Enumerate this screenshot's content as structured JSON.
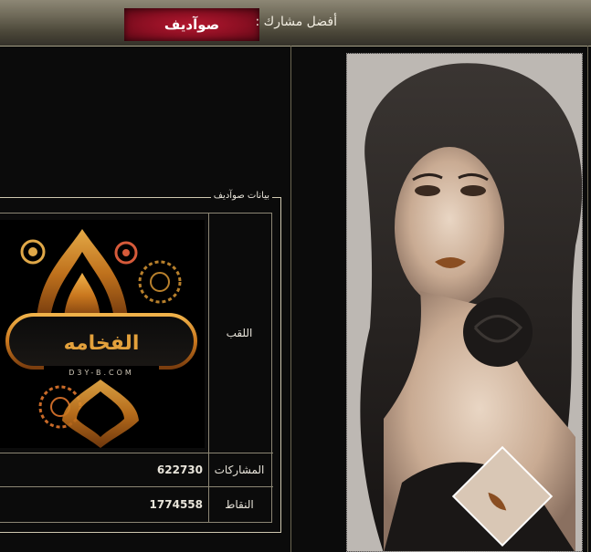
{
  "header": {
    "label": "أفضل مشارك :",
    "top_member_name": "صوآديف"
  },
  "profile_box": {
    "legend": "بيانات صوآديف",
    "rows": [
      {
        "label": "اللقب",
        "value": ""
      },
      {
        "label": "المشاركات",
        "value": "622730"
      },
      {
        "label": "النقاط",
        "value": "1774558"
      }
    ]
  },
  "title_image": {
    "main_text": "الفخامه",
    "site_text": "D3Y-B.COM"
  },
  "colors": {
    "badge_red": "#9b1428",
    "gold": "#c9902e",
    "border": "#cfc8b0"
  }
}
